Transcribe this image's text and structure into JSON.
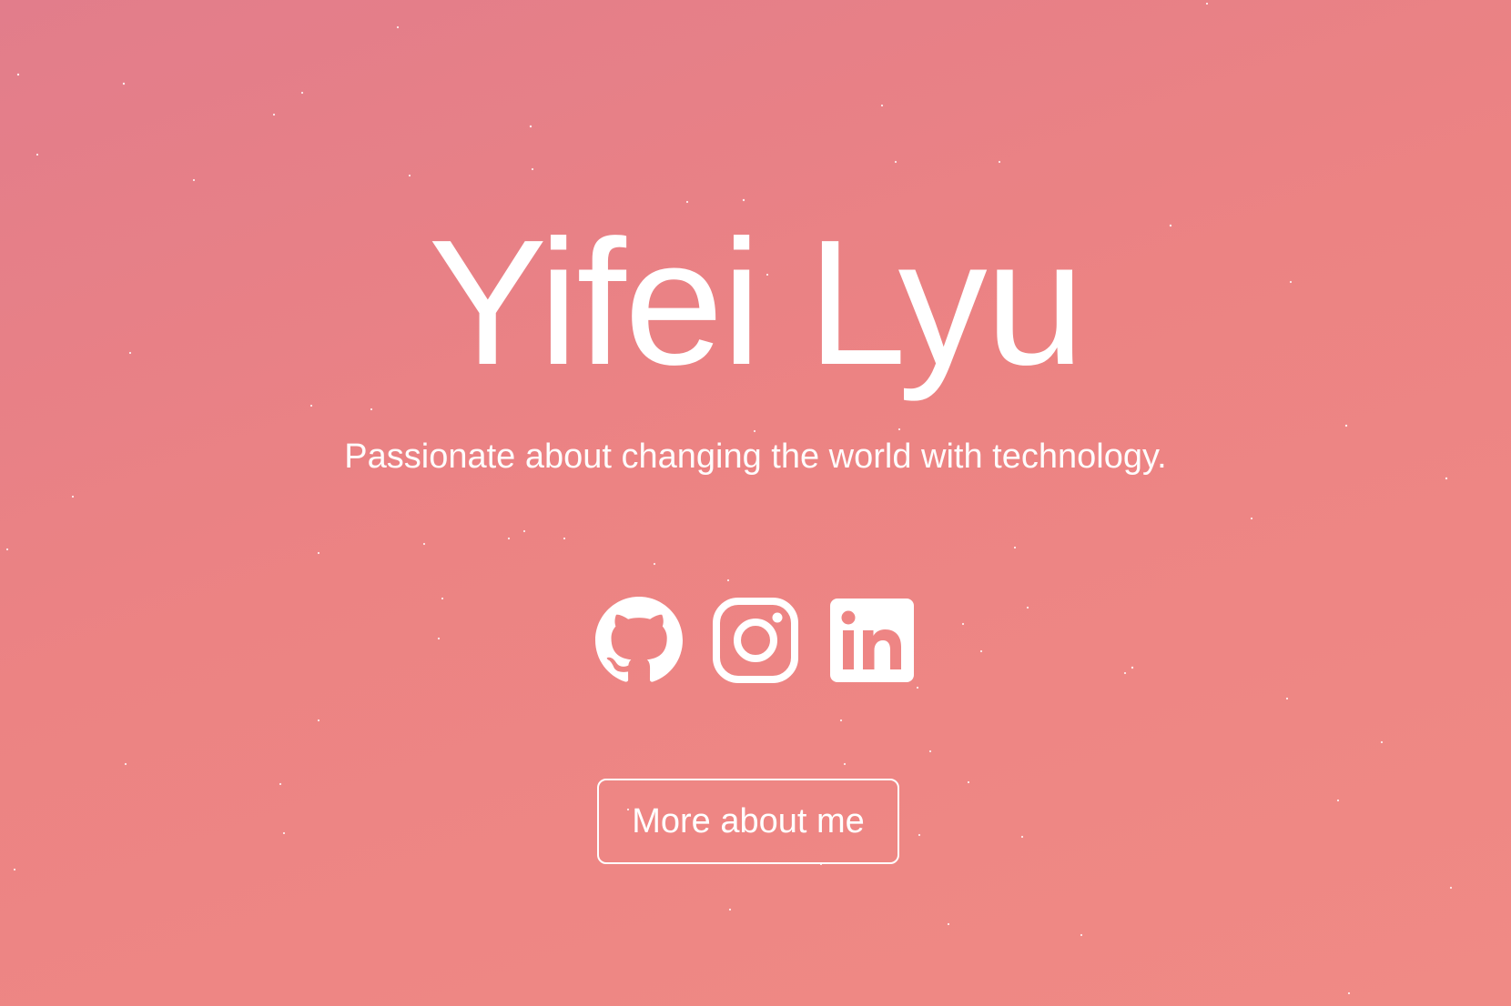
{
  "hero": {
    "name": "Yifei Lyu",
    "tagline": "Passionate about changing the world with technology."
  },
  "social": [
    {
      "icon": "github-icon"
    },
    {
      "icon": "instagram-icon"
    },
    {
      "icon": "linkedin-icon"
    }
  ],
  "cta": {
    "label": "More about me"
  },
  "colors": {
    "background_start": "#e27d8b",
    "background_end": "#f08a85",
    "foreground": "#ffffff"
  }
}
